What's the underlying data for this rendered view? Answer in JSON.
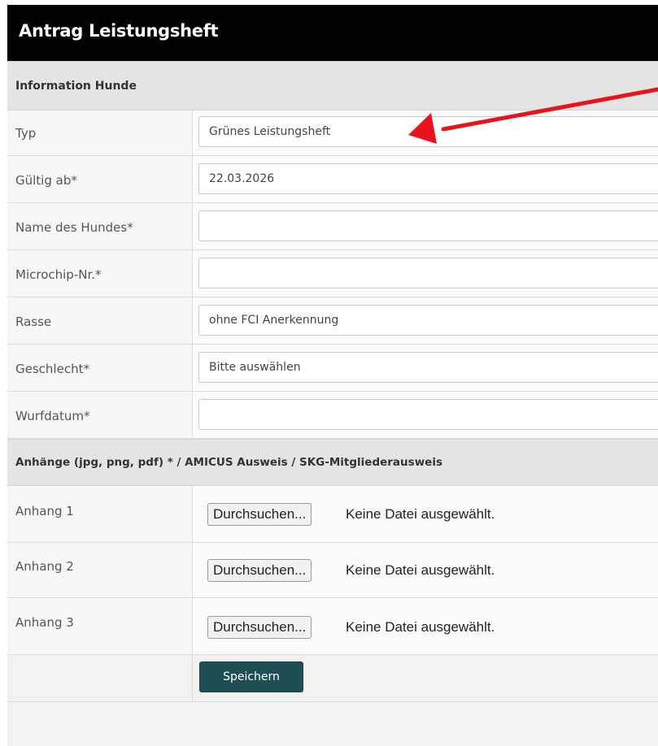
{
  "header": {
    "title": "Antrag Leistungsheft"
  },
  "section_info": {
    "title": "Information Hunde"
  },
  "fields": [
    {
      "label": "Typ",
      "value": "Grünes Leistungsheft"
    },
    {
      "label": "Gültig ab*",
      "value": "22.03.2026"
    },
    {
      "label": "Name des Hundes*",
      "value": ""
    },
    {
      "label": "Microchip-Nr.*",
      "value": ""
    },
    {
      "label": "Rasse",
      "value": "ohne FCI Anerkennung"
    },
    {
      "label": "Geschlecht*",
      "value": "Bitte auswählen"
    },
    {
      "label": "Wurfdatum*",
      "value": ""
    }
  ],
  "section_attachments": {
    "title": "Anhänge (jpg, png, pdf) * / AMICUS Ausweis / SKG-Mitgliederausweis"
  },
  "attachments": [
    {
      "label": "Anhang 1",
      "button": "Durchsuchen...",
      "status": "Keine Datei ausgewählt."
    },
    {
      "label": "Anhang 2",
      "button": "Durchsuchen...",
      "status": "Keine Datei ausgewählt."
    },
    {
      "label": "Anhang 3",
      "button": "Durchsuchen...",
      "status": "Keine Datei ausgewählt."
    }
  ],
  "save_label": "Speichern",
  "colors": {
    "header_bg": "#000000",
    "save_bg": "#1f4e54",
    "arrow": "#e8131b"
  }
}
